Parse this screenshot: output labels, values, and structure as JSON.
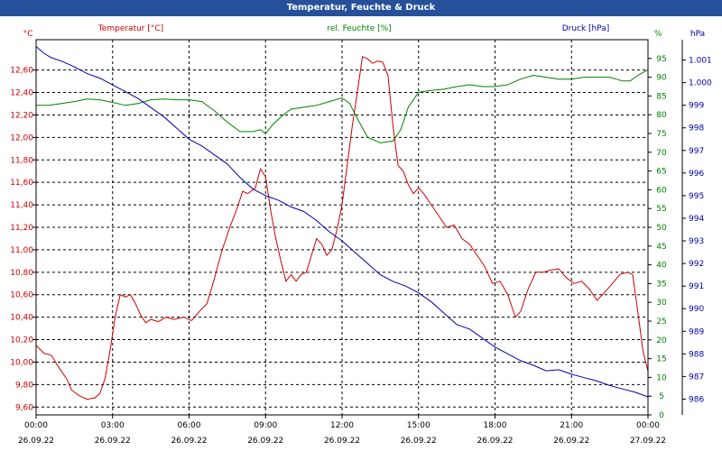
{
  "window": {
    "title": "Temperatur, Feuchte & Druck"
  },
  "colors": {
    "temperature": "#cc0000",
    "humidity": "#008000",
    "pressure": "#0000aa",
    "titlebar": "#27509b",
    "grid": "#000000"
  },
  "chart_data": {
    "type": "line",
    "title": "Temperatur, Feuchte & Druck",
    "grid": true,
    "x_ticks": [
      {
        "time": "00:00",
        "date": "26.09.22"
      },
      {
        "time": "03:00",
        "date": "26.09.22"
      },
      {
        "time": "06:00",
        "date": "26.09.22"
      },
      {
        "time": "09:00",
        "date": "26.09.22"
      },
      {
        "time": "12:00",
        "date": "26.09.22"
      },
      {
        "time": "15:00",
        "date": "26.09.22"
      },
      {
        "time": "18:00",
        "date": "26.09.22"
      },
      {
        "time": "21:00",
        "date": "26.09.22"
      },
      {
        "time": "00:00",
        "date": "27.09.22"
      }
    ],
    "x_range_hours": [
      0,
      24
    ],
    "axes": {
      "temperature": {
        "label": "Temperatur [°C]",
        "unit": "°C",
        "ylim": [
          9.53,
          12.87
        ],
        "ticks": [
          "9,60",
          "9,80",
          "10,00",
          "10,20",
          "10,40",
          "10,60",
          "10,80",
          "11,00",
          "11,20",
          "11,40",
          "11,60",
          "11,80",
          "12,00",
          "12,20",
          "12,40",
          "12,60"
        ]
      },
      "humidity": {
        "label": "rel. Feuchte [%]",
        "unit": "%",
        "ylim": [
          0,
          100
        ],
        "ticks": [
          "0",
          "5",
          "10",
          "15",
          "20",
          "25",
          "30",
          "35",
          "40",
          "45",
          "50",
          "55",
          "60",
          "65",
          "70",
          "75",
          "80",
          "85",
          "90",
          "95"
        ]
      },
      "pressure": {
        "label": "Druck [hPa]",
        "unit": "hPa",
        "ylim": [
          985.3,
          1001.9
        ],
        "ticks": [
          "986",
          "987",
          "988",
          "989",
          "990",
          "991",
          "992",
          "993",
          "994",
          "995",
          "996",
          "997",
          "998",
          "999",
          "1.000",
          "1.001"
        ]
      }
    },
    "series": [
      {
        "name": "Temperatur [°C]",
        "axis": "temperature",
        "points": [
          [
            0.0,
            10.15
          ],
          [
            0.3,
            10.08
          ],
          [
            0.6,
            10.06
          ],
          [
            0.9,
            9.95
          ],
          [
            1.2,
            9.85
          ],
          [
            1.4,
            9.75
          ],
          [
            1.7,
            9.7
          ],
          [
            2.0,
            9.67
          ],
          [
            2.3,
            9.68
          ],
          [
            2.5,
            9.72
          ],
          [
            2.7,
            9.85
          ],
          [
            2.9,
            10.1
          ],
          [
            3.1,
            10.4
          ],
          [
            3.3,
            10.6
          ],
          [
            3.5,
            10.58
          ],
          [
            3.7,
            10.6
          ],
          [
            3.9,
            10.52
          ],
          [
            4.1,
            10.42
          ],
          [
            4.3,
            10.35
          ],
          [
            4.5,
            10.38
          ],
          [
            4.8,
            10.36
          ],
          [
            5.1,
            10.4
          ],
          [
            5.4,
            10.38
          ],
          [
            5.8,
            10.4
          ],
          [
            6.1,
            10.37
          ],
          [
            6.4,
            10.45
          ],
          [
            6.7,
            10.52
          ],
          [
            7.0,
            10.75
          ],
          [
            7.3,
            11.0
          ],
          [
            7.6,
            11.2
          ],
          [
            7.9,
            11.38
          ],
          [
            8.1,
            11.52
          ],
          [
            8.3,
            11.5
          ],
          [
            8.6,
            11.55
          ],
          [
            8.8,
            11.72
          ],
          [
            9.0,
            11.65
          ],
          [
            9.2,
            11.35
          ],
          [
            9.4,
            11.1
          ],
          [
            9.6,
            10.9
          ],
          [
            9.8,
            10.72
          ],
          [
            10.0,
            10.78
          ],
          [
            10.2,
            10.72
          ],
          [
            10.4,
            10.78
          ],
          [
            10.6,
            10.8
          ],
          [
            10.8,
            10.95
          ],
          [
            11.0,
            11.1
          ],
          [
            11.2,
            11.05
          ],
          [
            11.4,
            10.95
          ],
          [
            11.6,
            11.0
          ],
          [
            11.8,
            11.18
          ],
          [
            12.0,
            11.4
          ],
          [
            12.2,
            11.75
          ],
          [
            12.4,
            12.1
          ],
          [
            12.6,
            12.4
          ],
          [
            12.8,
            12.72
          ],
          [
            13.0,
            12.7
          ],
          [
            13.2,
            12.66
          ],
          [
            13.4,
            12.68
          ],
          [
            13.6,
            12.67
          ],
          [
            13.8,
            12.55
          ],
          [
            14.0,
            12.1
          ],
          [
            14.2,
            11.75
          ],
          [
            14.4,
            11.7
          ],
          [
            14.6,
            11.58
          ],
          [
            14.8,
            11.5
          ],
          [
            15.0,
            11.55
          ],
          [
            15.2,
            11.5
          ],
          [
            15.5,
            11.4
          ],
          [
            15.8,
            11.3
          ],
          [
            16.1,
            11.2
          ],
          [
            16.4,
            11.22
          ],
          [
            16.7,
            11.1
          ],
          [
            17.0,
            11.05
          ],
          [
            17.3,
            10.95
          ],
          [
            17.6,
            10.85
          ],
          [
            17.9,
            10.7
          ],
          [
            18.2,
            10.72
          ],
          [
            18.5,
            10.6
          ],
          [
            18.8,
            10.4
          ],
          [
            19.0,
            10.45
          ],
          [
            19.3,
            10.65
          ],
          [
            19.6,
            10.8
          ],
          [
            19.9,
            10.8
          ],
          [
            20.2,
            10.82
          ],
          [
            20.5,
            10.83
          ],
          [
            20.8,
            10.75
          ],
          [
            21.1,
            10.7
          ],
          [
            21.4,
            10.72
          ],
          [
            21.7,
            10.65
          ],
          [
            22.0,
            10.55
          ],
          [
            22.3,
            10.62
          ],
          [
            22.6,
            10.7
          ],
          [
            22.9,
            10.78
          ],
          [
            23.2,
            10.8
          ],
          [
            23.4,
            10.78
          ],
          [
            23.6,
            10.45
          ],
          [
            23.8,
            10.1
          ],
          [
            24.0,
            9.92
          ]
        ]
      },
      {
        "name": "rel. Feuchte [%]",
        "axis": "humidity",
        "points": [
          [
            0.0,
            82.5
          ],
          [
            0.5,
            82.5
          ],
          [
            1.0,
            83
          ],
          [
            1.5,
            83.5
          ],
          [
            2.0,
            84.2
          ],
          [
            2.5,
            84
          ],
          [
            3.0,
            83.3
          ],
          [
            3.5,
            82.5
          ],
          [
            4.0,
            83
          ],
          [
            4.5,
            84
          ],
          [
            5.0,
            84.2
          ],
          [
            5.5,
            84
          ],
          [
            6.0,
            84
          ],
          [
            6.5,
            83.5
          ],
          [
            7.0,
            81
          ],
          [
            7.5,
            78
          ],
          [
            8.0,
            75.5
          ],
          [
            8.5,
            75.5
          ],
          [
            8.8,
            76
          ],
          [
            9.0,
            75
          ],
          [
            9.3,
            77.5
          ],
          [
            9.7,
            80
          ],
          [
            10.0,
            81.5
          ],
          [
            10.5,
            82
          ],
          [
            11.0,
            82.5
          ],
          [
            11.5,
            83.5
          ],
          [
            12.0,
            84.5
          ],
          [
            12.3,
            83
          ],
          [
            12.6,
            79
          ],
          [
            13.0,
            74
          ],
          [
            13.5,
            72.5
          ],
          [
            14.0,
            73
          ],
          [
            14.3,
            76
          ],
          [
            14.6,
            82
          ],
          [
            15.0,
            86
          ],
          [
            15.5,
            86.5
          ],
          [
            16.0,
            86.8
          ],
          [
            16.5,
            87.5
          ],
          [
            17.0,
            88
          ],
          [
            17.5,
            87.5
          ],
          [
            18.0,
            87.5
          ],
          [
            18.5,
            88
          ],
          [
            19.0,
            89.5
          ],
          [
            19.5,
            90.5
          ],
          [
            20.0,
            90
          ],
          [
            20.5,
            89.5
          ],
          [
            21.0,
            89.5
          ],
          [
            21.5,
            90
          ],
          [
            22.0,
            90
          ],
          [
            22.5,
            90
          ],
          [
            23.0,
            89
          ],
          [
            23.3,
            89
          ],
          [
            23.6,
            90.5
          ],
          [
            24.0,
            92
          ]
        ]
      },
      {
        "name": "Druck [hPa]",
        "axis": "pressure",
        "points": [
          [
            0.0,
            1001.6
          ],
          [
            0.3,
            1001.3
          ],
          [
            0.6,
            1001.1
          ],
          [
            1.0,
            1000.95
          ],
          [
            1.5,
            1000.7
          ],
          [
            2.0,
            1000.4
          ],
          [
            2.5,
            1000.2
          ],
          [
            3.0,
            999.9
          ],
          [
            3.5,
            999.6
          ],
          [
            4.0,
            999.3
          ],
          [
            4.5,
            998.9
          ],
          [
            5.0,
            998.5
          ],
          [
            5.5,
            998.0
          ],
          [
            6.0,
            997.5
          ],
          [
            6.5,
            997.2
          ],
          [
            7.0,
            996.8
          ],
          [
            7.5,
            996.4
          ],
          [
            8.0,
            995.8
          ],
          [
            8.5,
            995.3
          ],
          [
            9.0,
            995.0
          ],
          [
            9.5,
            994.8
          ],
          [
            10.0,
            994.5
          ],
          [
            10.5,
            994.3
          ],
          [
            11.0,
            993.9
          ],
          [
            11.5,
            993.4
          ],
          [
            12.0,
            993.0
          ],
          [
            12.5,
            992.5
          ],
          [
            13.0,
            992.0
          ],
          [
            13.5,
            991.5
          ],
          [
            14.0,
            991.2
          ],
          [
            14.5,
            991.0
          ],
          [
            15.0,
            990.7
          ],
          [
            15.5,
            990.3
          ],
          [
            16.0,
            989.8
          ],
          [
            16.5,
            989.3
          ],
          [
            17.0,
            989.1
          ],
          [
            17.5,
            988.7
          ],
          [
            18.0,
            988.3
          ],
          [
            18.5,
            988.0
          ],
          [
            19.0,
            987.7
          ],
          [
            19.5,
            987.5
          ],
          [
            20.0,
            987.25
          ],
          [
            20.5,
            987.3
          ],
          [
            21.0,
            987.1
          ],
          [
            21.5,
            986.95
          ],
          [
            22.0,
            986.8
          ],
          [
            22.5,
            986.6
          ],
          [
            23.0,
            986.45
          ],
          [
            23.5,
            986.3
          ],
          [
            24.0,
            986.1
          ]
        ]
      }
    ]
  }
}
